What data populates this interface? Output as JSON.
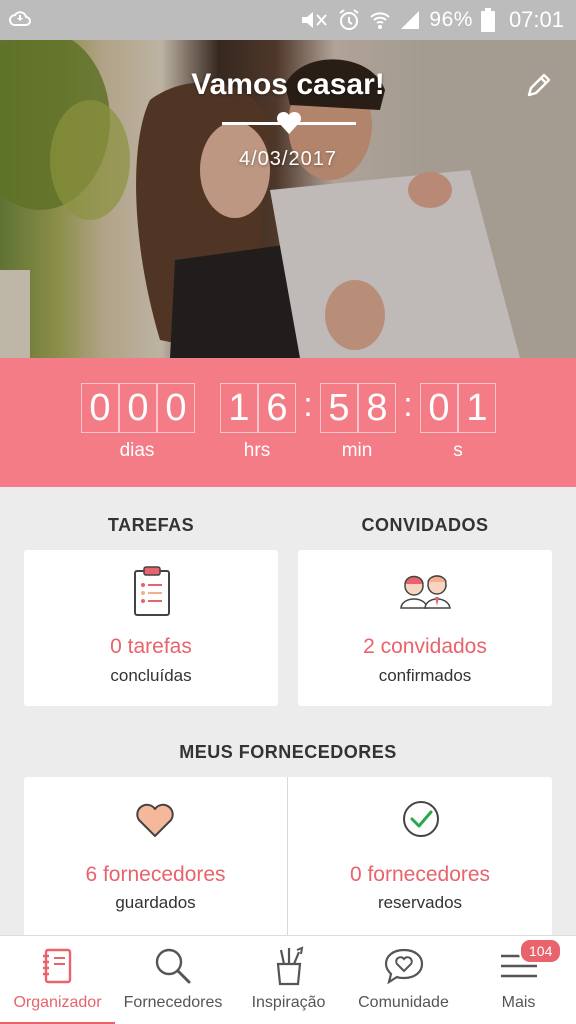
{
  "status_bar": {
    "battery_percent": "96%",
    "time": "07:01"
  },
  "hero": {
    "title": "Vamos casar!",
    "date": "4/03/2017"
  },
  "countdown": {
    "days_digits": [
      "0",
      "0",
      "0"
    ],
    "hours_digits": [
      "1",
      "6"
    ],
    "minutes_digits": [
      "5",
      "8"
    ],
    "seconds_digits": [
      "0",
      "1"
    ],
    "labels": {
      "days": "dias",
      "hours": "hrs",
      "minutes": "min",
      "seconds": "s"
    }
  },
  "tasks": {
    "title": "TAREFAS",
    "count": "0 tarefas",
    "sub": "concluídas"
  },
  "guests": {
    "title": "CONVIDADOS",
    "count": "2 convidados",
    "sub": "confirmados"
  },
  "vendors": {
    "title": "MEUS FORNECEDORES",
    "saved_count": "6 fornecedores",
    "saved_sub": "guardados",
    "booked_count": "0 fornecedores",
    "booked_sub": "reservados"
  },
  "bottom_nav": {
    "items": [
      {
        "label": "Organizador",
        "icon": "notebook-icon",
        "active": true
      },
      {
        "label": "Fornecedores",
        "icon": "search-icon",
        "active": false
      },
      {
        "label": "Inspiração",
        "icon": "pencil-cup-icon",
        "active": false
      },
      {
        "label": "Comunidade",
        "icon": "chat-heart-icon",
        "active": false
      },
      {
        "label": "Mais",
        "icon": "menu-icon",
        "active": false
      }
    ],
    "badge": "104"
  },
  "colors": {
    "accent": "#e8636c",
    "countdown_bg": "#f47c86",
    "status_bar_bg": "#bcbcbc"
  }
}
